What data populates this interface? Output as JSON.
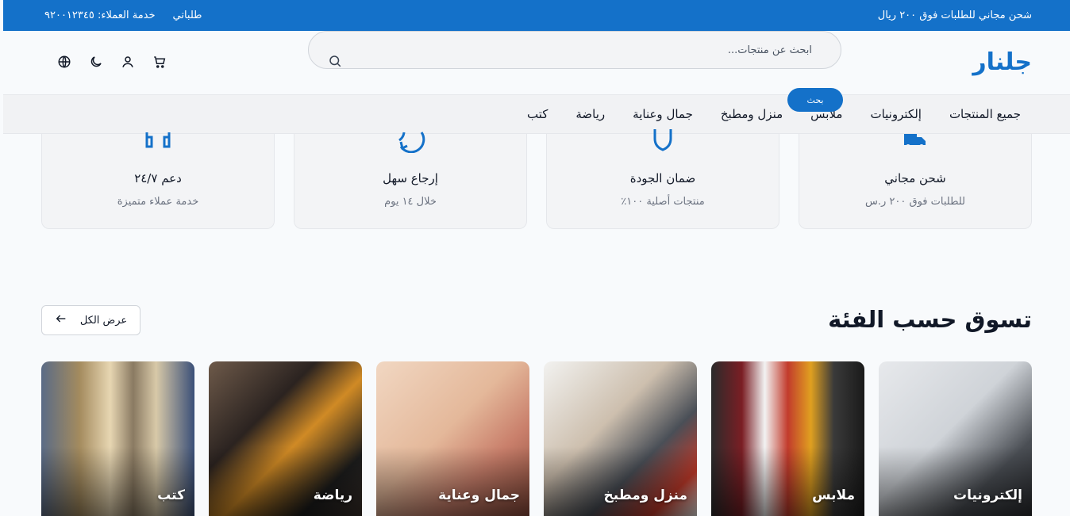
{
  "topbar": {
    "promo": "شحن مجاني للطلبات فوق ٢٠٠ ريال",
    "my_orders": "طلباتي",
    "customer_service": "خدمة العملاء: ٩٢٠٠١٢٣٤٥"
  },
  "header": {
    "logo": "جلنار",
    "search_placeholder": "ابحث عن منتجات...",
    "search_button": "بحث",
    "icons": [
      "language-icon",
      "dark-mode-icon",
      "user-icon",
      "cart-icon"
    ]
  },
  "nav": {
    "items": [
      {
        "label": "جميع المنتجات"
      },
      {
        "label": "إلكترونيات"
      },
      {
        "label": "ملابس"
      },
      {
        "label": "منزل ومطبخ"
      },
      {
        "label": "جمال وعناية"
      },
      {
        "label": "رياضة"
      },
      {
        "label": "كتب"
      }
    ]
  },
  "features": [
    {
      "title": "شحن مجاني",
      "subtitle": "للطلبات فوق ٢٠٠ ر.س",
      "icon": "truck-icon"
    },
    {
      "title": "ضمان الجودة",
      "subtitle": "منتجات أصلية ١٠٠٪",
      "icon": "shield-icon"
    },
    {
      "title": "إرجاع سهل",
      "subtitle": "خلال ١٤ يوم",
      "icon": "refresh-icon"
    },
    {
      "title": "دعم ٢٤/٧",
      "subtitle": "خدمة عملاء متميزة",
      "icon": "headset-icon"
    }
  ],
  "section": {
    "title": "تسوق حسب الفئة",
    "view_all": "عرض الكل"
  },
  "categories": [
    {
      "label": "إلكترونيات"
    },
    {
      "label": "ملابس"
    },
    {
      "label": "منزل ومطبخ"
    },
    {
      "label": "جمال وعناية"
    },
    {
      "label": "رياضة"
    },
    {
      "label": "كتب"
    }
  ],
  "colors": {
    "brand": "#1471c9",
    "background": "#f8fafc"
  }
}
